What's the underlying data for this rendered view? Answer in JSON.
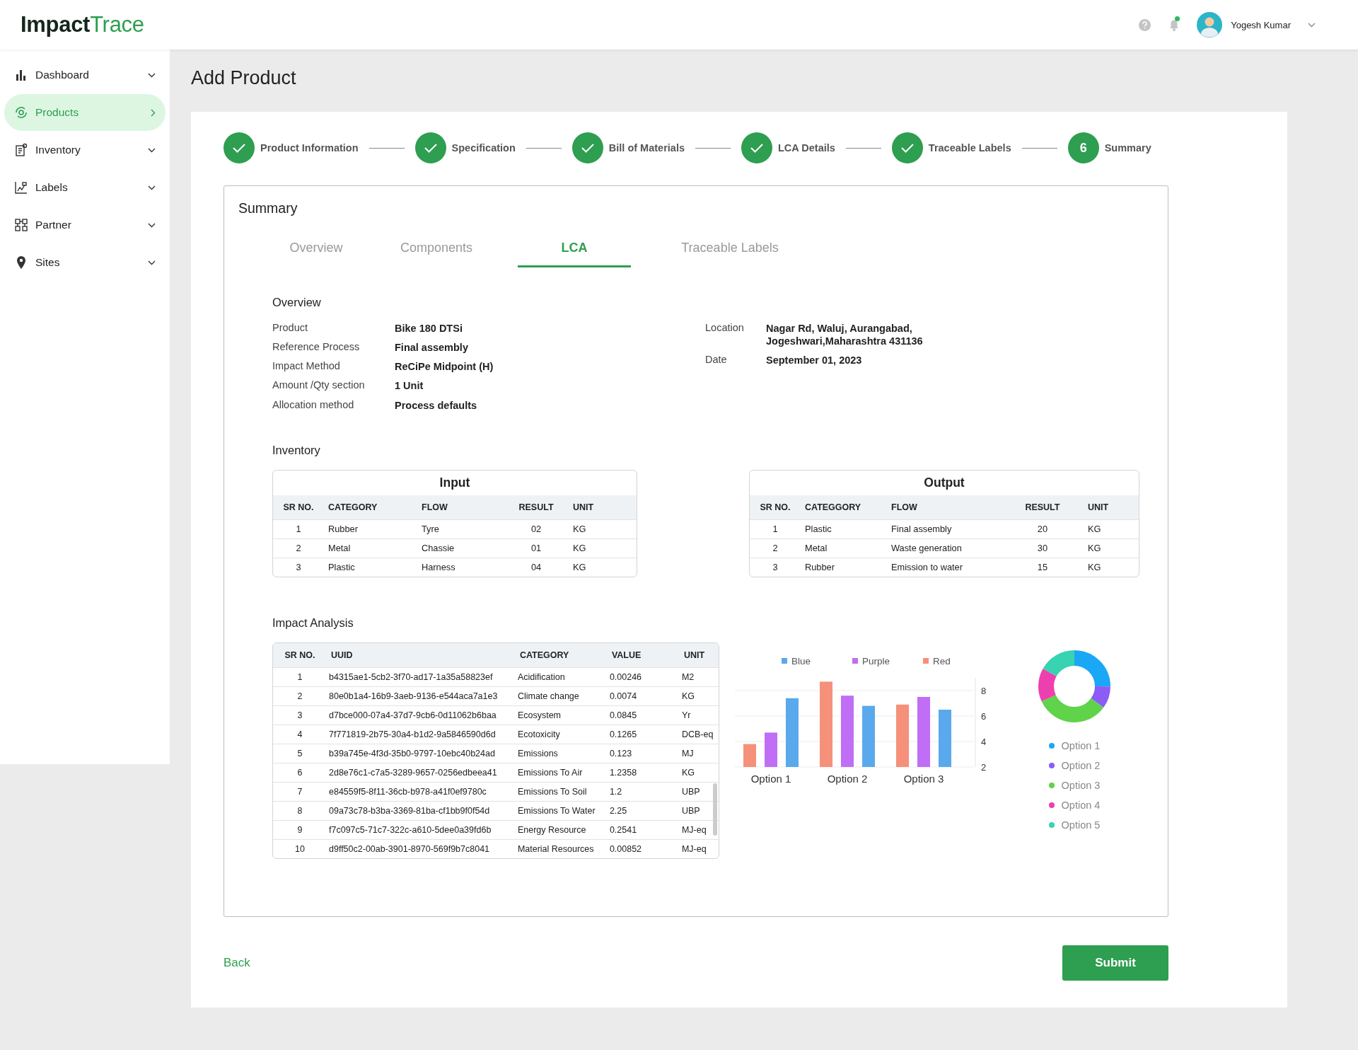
{
  "header": {
    "logo_primary": "Impact",
    "logo_secondary": "Trace",
    "notification_unread": true,
    "user_name": "Yogesh Kumar"
  },
  "sidebar": {
    "items": [
      {
        "label": "Dashboard",
        "selected": false
      },
      {
        "label": "Products",
        "selected": true
      },
      {
        "label": "Inventory",
        "selected": false
      },
      {
        "label": "Labels",
        "selected": false
      },
      {
        "label": "Partner",
        "selected": false
      },
      {
        "label": "Sites",
        "selected": false
      }
    ]
  },
  "page_title": "Add Product",
  "stepper": [
    {
      "label": "Product Information",
      "done": true
    },
    {
      "label": "Specification",
      "done": true
    },
    {
      "label": "Bill of Materials",
      "done": true
    },
    {
      "label": "LCA Details",
      "done": true
    },
    {
      "label": "Traceable Labels",
      "done": true
    },
    {
      "label": "Summary",
      "done": false,
      "number": "6"
    }
  ],
  "summary": {
    "title": "Summary",
    "tabs": [
      {
        "label": "Overview",
        "selected": false
      },
      {
        "label": "Components",
        "selected": false
      },
      {
        "label": "LCA",
        "selected": true
      },
      {
        "label": "Traceable Labels",
        "selected": false
      }
    ],
    "overview": {
      "title": "Overview",
      "left": [
        {
          "label": "Product",
          "value": "Bike  180 DTSi"
        },
        {
          "label": "Reference Process",
          "value": "Final assembly"
        },
        {
          "label": "Impact Method",
          "value": "ReCiPe Midpoint (H)"
        },
        {
          "label": "Amount /Qty section",
          "value": "1 Unit"
        },
        {
          "label": "Allocation method",
          "value": "Process defaults"
        }
      ],
      "right": [
        {
          "label": "Location",
          "value": "Nagar Rd, Waluj, Aurangabad,\nJogeshwari,Maharashtra 431136"
        },
        {
          "label": "Date",
          "value": "September 01, 2023"
        }
      ]
    },
    "inventory": {
      "title": "Inventory",
      "tables": [
        {
          "title": "Input",
          "columns": [
            "SR NO.",
            "CATEGORY",
            "FLOW",
            "RESULT",
            "UNIT"
          ],
          "rows": [
            [
              "1",
              "Rubber",
              "Tyre",
              "02",
              "KG"
            ],
            [
              "2",
              "Metal",
              "Chassie",
              "01",
              "KG"
            ],
            [
              "3",
              "Plastic",
              "Harness",
              "04",
              "KG"
            ]
          ]
        },
        {
          "title": "Output",
          "columns": [
            "SR NO.",
            "CATEGGORY",
            "FLOW",
            "RESULT",
            "UNIT"
          ],
          "rows": [
            [
              "1",
              "Plastic",
              "Final assembly",
              "20",
              "KG"
            ],
            [
              "2",
              "Metal",
              "Waste generation",
              "30",
              "KG"
            ],
            [
              "3",
              "Rubber",
              "Emission to water",
              "15",
              "KG"
            ]
          ]
        }
      ]
    },
    "impact": {
      "title": "Impact Analysis",
      "columns": [
        "SR NO.",
        "UUID",
        "CATEGORY",
        "VALUE",
        "UNIT"
      ],
      "rows": [
        [
          "1",
          "b4315ae1-5cb2-3f70-ad17-1a35a58823ef",
          "Acidification",
          "0.00246",
          "M2"
        ],
        [
          "2",
          "80e0b1a4-16b9-3aeb-9136-e544aca7a1e3",
          "Climate change",
          "0.0074",
          "KG"
        ],
        [
          "3",
          "d7bce000-07a4-37d7-9cb6-0d11062b6baa",
          "Ecosystem",
          "0.0845",
          "Yr"
        ],
        [
          "4",
          "7f771819-2b75-30a4-b1d2-9a5846590d6d",
          "Ecotoxicity",
          "0.1265",
          "DCB-eq"
        ],
        [
          "5",
          "b39a745e-4f3d-35b0-9797-10ebc40b24ad",
          "Emissions",
          "0.123",
          "MJ"
        ],
        [
          "6",
          "2d8e76c1-c7a5-3289-9657-0256edbeea41",
          "Emissions To Air",
          "1.2358",
          "KG"
        ],
        [
          "7",
          "e84559f5-8f11-36cb-b978-a41f0ef9780c",
          "Emissions To Soil",
          "1.2",
          "UBP"
        ],
        [
          "8",
          "09a73c78-b3ba-3369-81ba-cf1bb9f0f54d",
          "Emissions To Water",
          "2.25",
          "UBP"
        ],
        [
          "9",
          "f7c097c5-71c7-322c-a610-5dee0a39fd6b",
          "Energy Resource",
          "0.2541",
          "MJ-eq"
        ],
        [
          "10",
          "d9ff50c2-00ab-3901-8970-569f9b7c8041",
          "Material Resources",
          "0.00852",
          "MJ-eq"
        ]
      ],
      "chart_data": {
        "type": "bar",
        "categories": [
          "Option 1",
          "Option 2",
          "Option 3"
        ],
        "series": [
          {
            "name": "Blue",
            "color": "#5aa9ec",
            "values": [
              7.4,
              6.8,
              6.5
            ]
          },
          {
            "name": "Purple",
            "color": "#c06ef5",
            "values": [
              4.7,
              7.6,
              7.5
            ]
          },
          {
            "name": "Red",
            "color": "#f5907a",
            "values": [
              3.8,
              8.7,
              6.9
            ]
          }
        ],
        "ylim": [
          2,
          9
        ],
        "yticks": [
          2,
          4,
          6,
          8
        ],
        "grid": true,
        "legend": "top"
      },
      "donut_legend": [
        {
          "label": "Option 1",
          "color": "#1aa7f5"
        },
        {
          "label": "Option 2",
          "color": "#8b5cf6"
        },
        {
          "label": "Option 3",
          "color": "#5fd34a"
        },
        {
          "label": "Option 4",
          "color": "#ee3fb0"
        },
        {
          "label": "Option 5",
          "color": "#37d3b2"
        }
      ]
    }
  },
  "footer": {
    "back": "Back",
    "submit": "Submit"
  }
}
